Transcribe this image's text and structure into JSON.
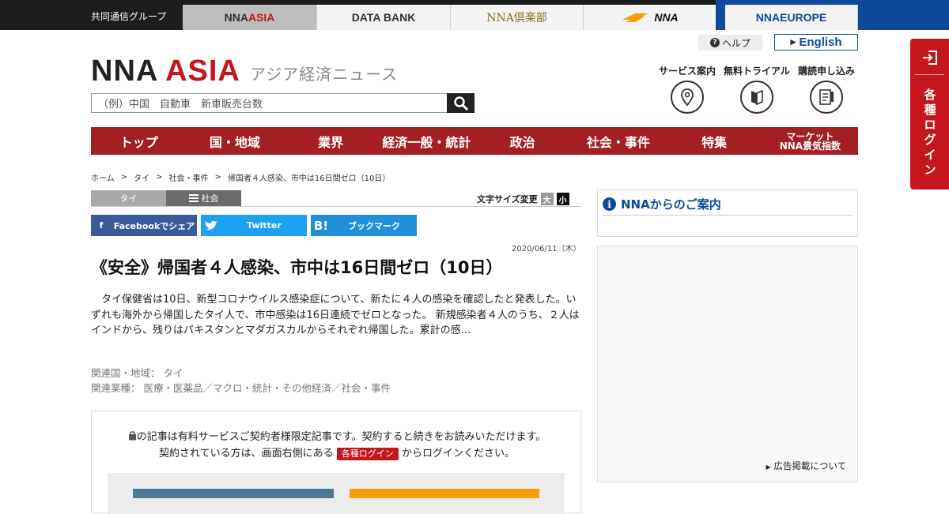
{
  "topbar": {
    "group": "共同通信グループ",
    "tabs": [
      {
        "label_a": "NNA ",
        "label_b": "ASIA"
      },
      {
        "label_a": "DATA BANK",
        "label_b": ""
      },
      {
        "label_a": "NNA倶楽部",
        "label_b": ""
      },
      {
        "label_a": "NNA",
        "label_b": ""
      },
      {
        "label_a": "NNA ",
        "label_b": "EUROPE"
      }
    ]
  },
  "header": {
    "help": "ヘルプ",
    "english": "English",
    "logo_a": "NNA ",
    "logo_b": "ASIA",
    "tagline": "アジア経済ニュース",
    "search_placeholder": "（例）中国　自動車　新車販売台数",
    "services": [
      "サービス案内",
      "無料トライアル",
      "購読申し込み"
    ]
  },
  "side_login": "各種ログイン",
  "nav": [
    "トップ",
    "国・地域",
    "業界",
    "経済一般・統計",
    "政治",
    "社会・事件",
    "特集"
  ],
  "nav_market": [
    "マーケット",
    "NNA景気指数"
  ],
  "breadcrumb": [
    "ホーム",
    "タイ",
    "社会・事件",
    "帰国者４人感染、市中は16日間ゼロ（10日）"
  ],
  "tags": [
    "タイ",
    "社会"
  ],
  "fontsize": {
    "label": "文字サイズ変更",
    "big": "大",
    "small": "小"
  },
  "share": {
    "facebook": "Facebookでシェア",
    "twitter": "Twitter",
    "hatena": "ブックマーク",
    "hatena_icon": "B!"
  },
  "article": {
    "date": "2020/06/11（木）",
    "headline": "《安全》帰国者４人感染、市中は16日間ゼロ（10日）",
    "lead": "タイ保健省は10日、新型コロナウイルス感染症について、新たに４人の感染を確認したと発表した。いずれも海外から帰国したタイ人で、市中感染は16日連続でゼロとなった。 新規感染者４人のうち、２人はインドから、残りはパキスタンとマダガスカルからそれぞれ帰国した。累計の感…",
    "related_country": "関連国・地域： タイ",
    "related_industry": "関連業種： 医療・医薬品／マクロ・統計・その他経済／社会・事件"
  },
  "paywall": {
    "line1": "の記事は有料サービスご契約者様限定記事です。契約すると続きをお読みいただけます。",
    "line2a": "契約されている方は、画面右側にある",
    "login_chip": "各種ログイン",
    "line2b": "からログインください。"
  },
  "sidebar": {
    "info_title": "NNAからのご案内",
    "ad_link": "広告掲載について"
  }
}
